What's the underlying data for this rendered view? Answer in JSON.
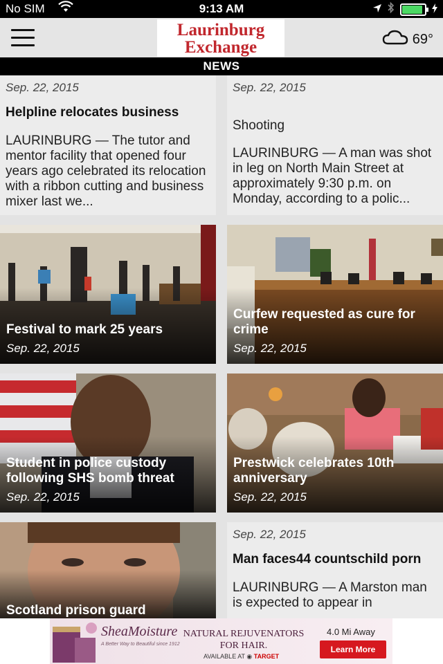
{
  "status_bar": {
    "carrier": "No SIM",
    "time": "9:13 AM"
  },
  "header": {
    "logo_line1": "Laurinburg",
    "logo_line2": "Exchange",
    "weather_temp": "69°",
    "weather_icon": "cloud-icon"
  },
  "section": {
    "title": "NEWS"
  },
  "articles": [
    {
      "date": "Sep. 22, 2015",
      "title": "Helpline relocates business",
      "body": "LAURINBURG — The tutor and mentor facility that opened four years ago celebrated its relocation with a ribbon cutting and business mixer last we..."
    },
    {
      "date": "Sep. 22, 2015",
      "title": "Shooting",
      "body": "LAURINBURG — A man was shot in leg on North Main Street at approximately 9:30 p.m. on Monday, according to a polic..."
    },
    {
      "date": "Sep. 22, 2015",
      "title": "Festival to mark 25 years"
    },
    {
      "date": "Sep. 22, 2015",
      "title": "Curfew requested as cure for crime"
    },
    {
      "date": "Sep. 22, 2015",
      "title": "Student in police custody following SHS bomb threat"
    },
    {
      "date": "Sep. 22, 2015",
      "title": "Prestwick celebrates 10th anniversary"
    },
    {
      "date": "",
      "title": "Scotland prison guard"
    },
    {
      "date": "Sep. 22, 2015",
      "title": "Man faces44 countschild porn",
      "body": "LAURINBURG — A Marston man is expected to appear in"
    }
  ],
  "ad": {
    "brand": "SheaMoisture",
    "tagline": "A Better Way to Beautiful since 1912",
    "headline": "NATURAL REJUVENATORS FOR HAIR.",
    "available": "AVAILABLE AT",
    "retailer": "TARGET",
    "distance": "4.0 Mi Away",
    "button": "Learn More"
  }
}
